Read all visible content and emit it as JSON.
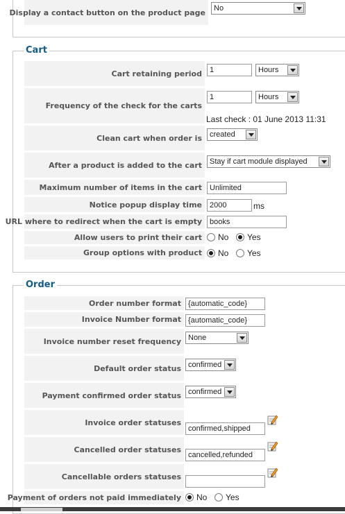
{
  "top": {
    "contact_label": "Display a contact button on the product page",
    "contact_value": "No"
  },
  "cart": {
    "legend": "Cart",
    "retaining_label": "Cart retaining period",
    "retaining_value": "1",
    "retaining_unit": "Hours",
    "frequency_label": "Frequency of the check for the carts",
    "frequency_value": "1",
    "frequency_unit": "Hours",
    "last_check": "Last check : 01 June 2013 11:31",
    "clean_label": "Clean cart when order is",
    "clean_value": "created",
    "after_add_label": "After a product is added to the cart",
    "after_add_value": "Stay if cart module displayed",
    "max_items_label": "Maximum number of items in the cart",
    "max_items_value": "Unlimited",
    "popup_label": "Notice popup display time",
    "popup_value": "2000",
    "popup_unit": "ms",
    "redirect_label": "URL where to redirect when the cart is empty",
    "redirect_value": "books",
    "print_label": "Allow users to print their cart",
    "print_no": "No",
    "print_yes": "Yes",
    "print_selected": "Yes",
    "group_label": "Group options with product",
    "group_no": "No",
    "group_yes": "Yes",
    "group_selected": "No"
  },
  "order": {
    "legend": "Order",
    "number_format_label": "Order number format",
    "number_format_value": "{automatic_code}",
    "invoice_format_label": "Invoice Number format",
    "invoice_format_value": "{automatic_code}",
    "reset_label": "Invoice number reset frequency",
    "reset_value": "None",
    "default_status_label": "Default order status",
    "default_status_value": "confirmed",
    "payment_confirmed_label": "Payment confirmed order status",
    "payment_confirmed_value": "confirmed",
    "invoice_statuses_label": "Invoice order statuses",
    "invoice_statuses_value": "confirmed,shipped",
    "cancelled_label": "Cancelled order statuses",
    "cancelled_value": "cancelled,refunded",
    "cancellable_label": "Cancellable orders statuses",
    "cancellable_value": "",
    "not_paid_label": "Payment of orders not paid immediately",
    "not_paid_no": "No",
    "not_paid_yes": "Yes",
    "not_paid_selected": "No"
  },
  "icons": {
    "edit": "edit-pencil-icon"
  }
}
